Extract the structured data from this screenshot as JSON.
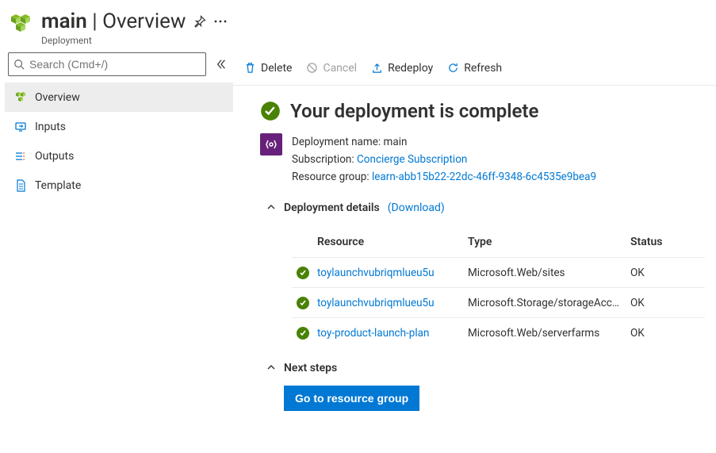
{
  "header": {
    "title_bold": "main",
    "title_sep": " | ",
    "title_rest": "Overview",
    "subtitle": "Deployment"
  },
  "sidebar": {
    "search_placeholder": "Search (Cmd+/)",
    "items": [
      {
        "label": "Overview"
      },
      {
        "label": "Inputs"
      },
      {
        "label": "Outputs"
      },
      {
        "label": "Template"
      }
    ]
  },
  "toolbar": {
    "delete": "Delete",
    "cancel": "Cancel",
    "redeploy": "Redeploy",
    "refresh": "Refresh"
  },
  "status": {
    "title": "Your deployment is complete"
  },
  "info": {
    "dep_label": "Deployment name:",
    "dep_value": "main",
    "sub_label": "Subscription:",
    "sub_value": "Concierge Subscription",
    "rg_label": "Resource group:",
    "rg_value": "learn-abb15b22-22dc-46ff-9348-6c4535e9bea9"
  },
  "details": {
    "title": "Deployment details",
    "download": "(Download)",
    "cols": {
      "resource": "Resource",
      "type": "Type",
      "status": "Status"
    },
    "rows": [
      {
        "resource": "toylaunchvubriqmlueu5u",
        "type": "Microsoft.Web/sites",
        "status": "OK"
      },
      {
        "resource": "toylaunchvubriqmlueu5u",
        "type": "Microsoft.Storage/storageAcc…",
        "status": "OK"
      },
      {
        "resource": "toy-product-launch-plan",
        "type": "Microsoft.Web/serverfarms",
        "status": "OK"
      }
    ]
  },
  "next": {
    "title": "Next steps",
    "button": "Go to resource group"
  },
  "colors": {
    "accent": "#0078d4",
    "success": "#498205",
    "badge": "#68217a"
  }
}
